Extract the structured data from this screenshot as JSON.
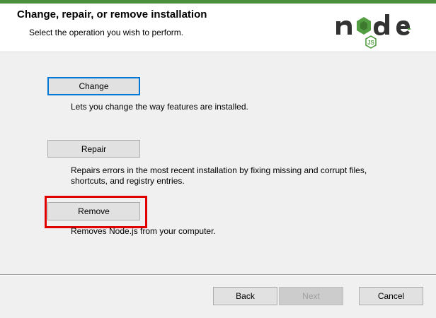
{
  "header": {
    "title": "Change, repair, or remove installation",
    "subtitle": "Select the operation you wish to perform.",
    "logo": "node-js-logo"
  },
  "options": {
    "change": {
      "label": "Change",
      "description": "Lets you change the way features are installed."
    },
    "repair": {
      "label": "Repair",
      "description_line1": "Repairs errors in the most recent installation by fixing missing and corrupt files,",
      "description_line2": "shortcuts, and registry entries."
    },
    "remove": {
      "label": "Remove",
      "description": "Removes Node.js from your computer."
    }
  },
  "footer": {
    "back_label": "Back",
    "next_label": "Next",
    "cancel_label": "Cancel"
  },
  "colors": {
    "accent_focus": "#0078d7",
    "highlight": "#e00000",
    "node_green": "#539e43",
    "node_dark": "#333333"
  }
}
